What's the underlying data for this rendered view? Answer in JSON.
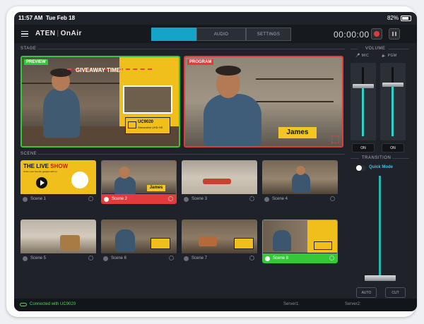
{
  "status": {
    "time": "11:57 AM",
    "date": "Tue Feb 18",
    "battery": "82%"
  },
  "header": {
    "logo": "ATEN",
    "product": "OnAir",
    "tabs": [
      {
        "label": ""
      },
      {
        "label": "AUDIO"
      },
      {
        "label": "SETTINGS"
      }
    ],
    "timer": "00:00:00"
  },
  "stage": {
    "label": "STAGE",
    "preview": {
      "badge": "PREVIEW",
      "banner": "GIVEAWAY TIME!",
      "product_name": "UC9020",
      "product_sub": "Streamlink UHD HS"
    },
    "program": {
      "badge": "PROGRAM",
      "name_tag": "James"
    }
  },
  "scene": {
    "label": "SCENE",
    "tiles": [
      {
        "label": "Scene 1",
        "state": "none",
        "title_a": "THE LIVE",
        "title_b": "SHOW",
        "subtitle": "Unbox your favorite gadgets with us",
        "name_tag": ""
      },
      {
        "label": "Scene 2",
        "state": "program",
        "name_tag": "James"
      },
      {
        "label": "Scene 3",
        "state": "none",
        "name_tag": ""
      },
      {
        "label": "Scene 4",
        "state": "none",
        "name_tag": ""
      },
      {
        "label": "Scene 5",
        "state": "none",
        "name_tag": ""
      },
      {
        "label": "Scene 6",
        "state": "none",
        "name_tag": ""
      },
      {
        "label": "Scene 7",
        "state": "none",
        "name_tag": ""
      },
      {
        "label": "Scene 8",
        "state": "preview",
        "name_tag": ""
      }
    ]
  },
  "volume": {
    "label": "VOLUME",
    "channels": [
      {
        "name": "MIC",
        "button": "ON",
        "level": 0.72
      },
      {
        "name": "PGM",
        "button": "ON",
        "level": 0.75
      }
    ]
  },
  "transition": {
    "label": "TRANSITION",
    "quick_mode_label": "Quick Mode",
    "auto_label": "AUTO",
    "cut_label": "CUT",
    "position": 0.0
  },
  "footer": {
    "connection": "Connected with UC9020",
    "server1_label": "Server1:",
    "server2_label": "Server2:",
    "server1_status": "",
    "server2_status": ""
  },
  "colors": {
    "accent": "#15a3c7",
    "preview": "#35c93a",
    "program": "#e23b3b",
    "name_tag": "#f3c623"
  }
}
